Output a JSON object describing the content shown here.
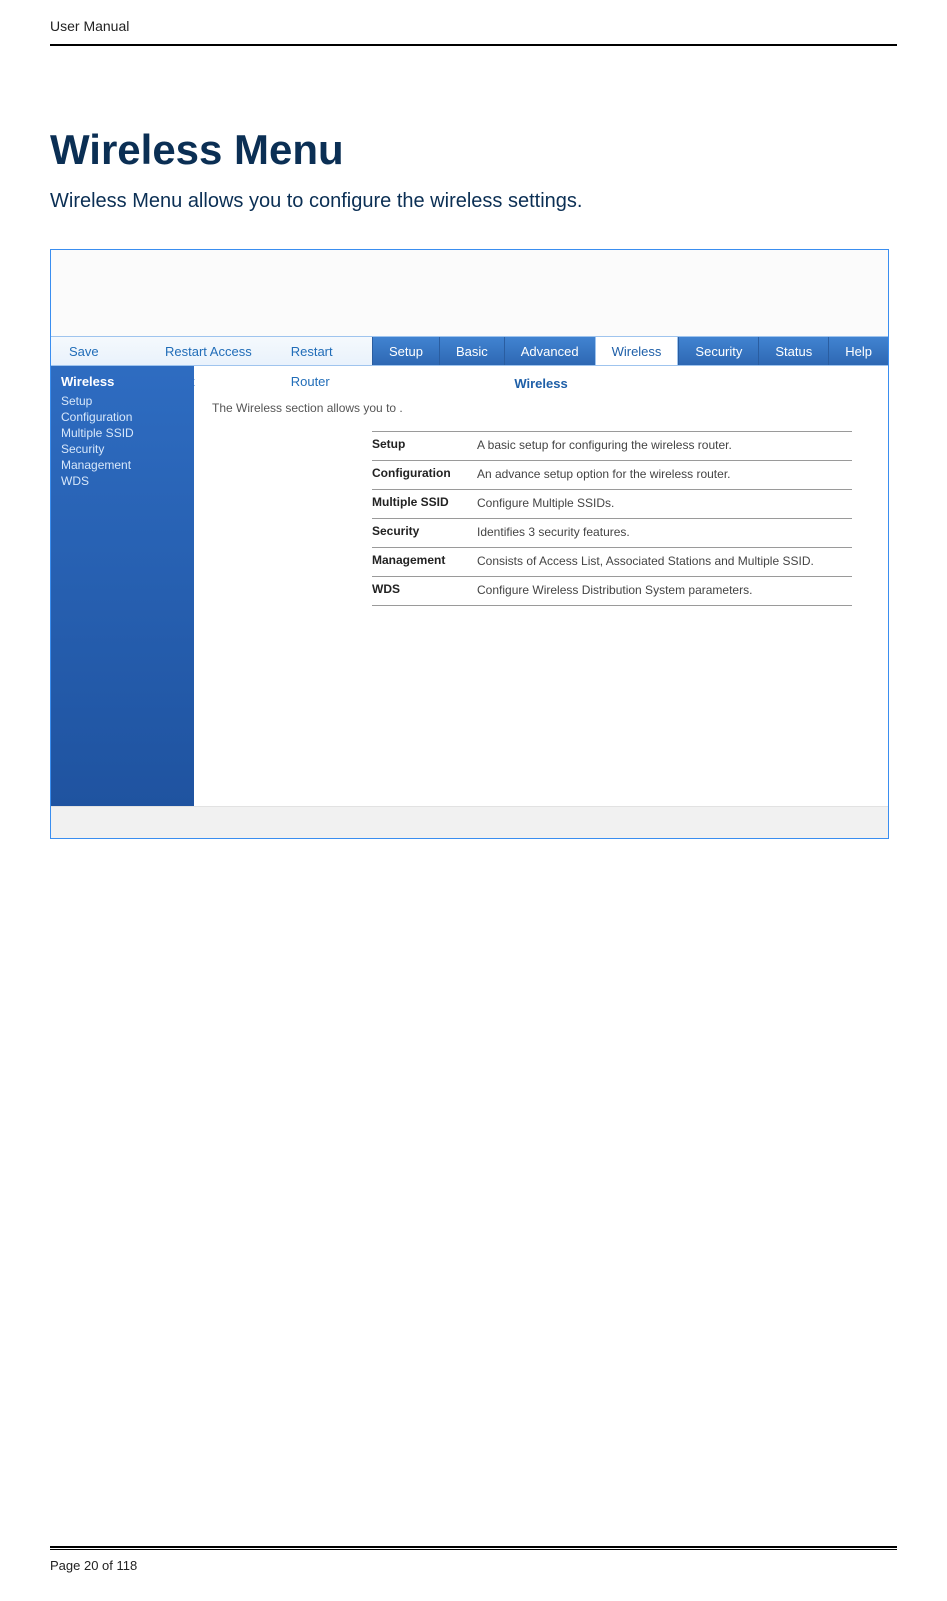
{
  "doc": {
    "header": "User Manual",
    "title": "Wireless Menu",
    "subtitle": "Wireless Menu allows you to configure the wireless settings.",
    "page_label": "Page 20 of 118"
  },
  "topbar": {
    "save": "Save Settings",
    "restart_ap": "Restart Access Point",
    "restart_router": "Restart Router"
  },
  "tabs": {
    "setup": "Setup",
    "basic": "Basic",
    "advanced": "Advanced",
    "wireless": "Wireless",
    "security": "Security",
    "status": "Status",
    "help": "Help"
  },
  "sidebar": {
    "title": "Wireless",
    "items": [
      "Setup",
      "Configuration",
      "Multiple SSID",
      "Security",
      "Management",
      "WDS"
    ]
  },
  "content": {
    "title": "Wireless",
    "intro": "The Wireless section allows you to .",
    "rows": [
      {
        "term": "Setup",
        "desc": "A basic setup for configuring the wireless router."
      },
      {
        "term": "Configuration",
        "desc": "An advance setup option for the wireless router."
      },
      {
        "term": "Multiple SSID",
        "desc": "Configure Multiple SSIDs."
      },
      {
        "term": "Security",
        "desc": "Identifies 3 security features."
      },
      {
        "term": "Management",
        "desc": "Consists of Access List, Associated Stations and Multiple SSID."
      },
      {
        "term": "WDS",
        "desc": "Configure Wireless Distribution System parameters."
      }
    ]
  }
}
